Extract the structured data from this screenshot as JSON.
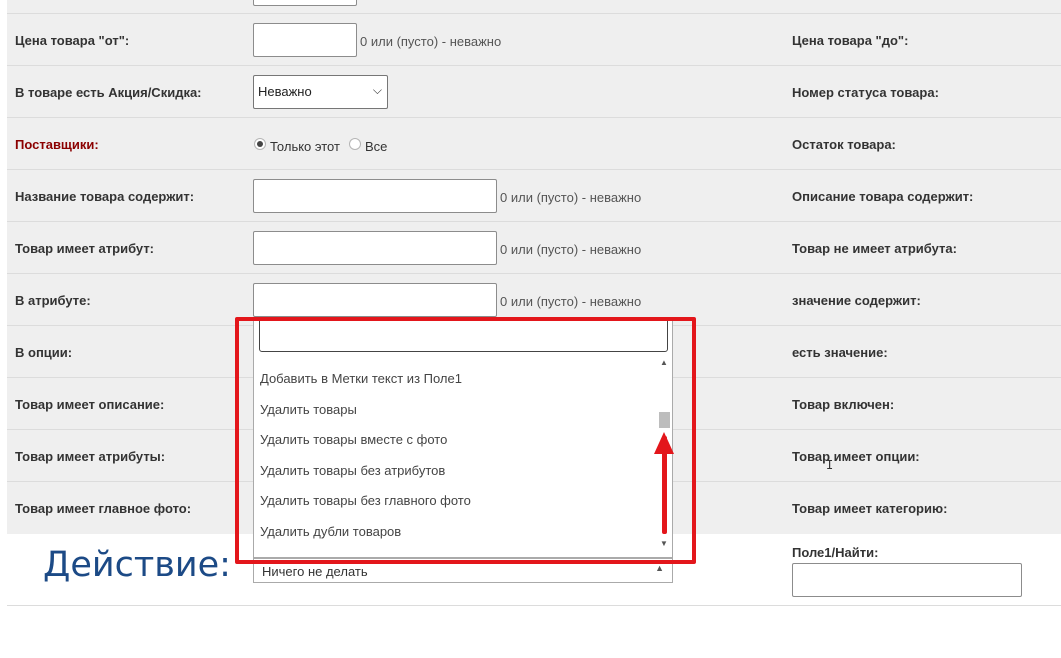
{
  "form": {
    "price_from_label": "Цена товара \"от\":",
    "price_from_hint": "0 или (пусто) - неважно",
    "price_to_label": "Цена товара \"до\":",
    "promo_label": "В товаре есть Акция/Скидка:",
    "promo_value": "Неважно",
    "status_number_label": "Номер статуса товара:",
    "suppliers_label": "Поставщики:",
    "supplier_only_this": "Только этот",
    "supplier_all": "Все",
    "stock_label": "Остаток товара:",
    "name_contains_label": "Название товара содержит:",
    "name_contains_hint": "0 или (пусто) - неважно",
    "description_contains_label": "Описание товара содержит:",
    "has_attribute_label": "Товар имеет атрибут:",
    "has_attribute_hint": "0 или (пусто) - неважно",
    "no_attribute_label": "Товар не имеет атрибута:",
    "in_attribute_label": "В атрибуте:",
    "in_attribute_hint": "0 или (пусто) - неважно",
    "value_contains_label": "значение содержит:",
    "in_option_label": "В опции:",
    "has_value_label": "есть значение:",
    "has_description_label": "Товар имеет описание:",
    "enabled_label": "Товар включен:",
    "has_attributes_label": "Товар имеет атрибуты:",
    "has_options_label": "Товар имеет опции:",
    "has_main_photo_label": "Товар имеет главное фото:",
    "has_category_label": "Товар имеет категорию:"
  },
  "action": {
    "title": "Действие:",
    "selected": "Ничего не делать",
    "field1_label": "Поле1/Найти:"
  },
  "dropdown": {
    "items": [
      "Добавить в Метки текст из Поле1",
      "Удалить товары",
      "Удалить товары вместе с фото",
      "Удалить товары без атрибутов",
      "Удалить товары без главного фото",
      "Удалить дубли товаров"
    ]
  },
  "colors": {
    "annotation": "#e3161b",
    "supplier_label": "#8b0000",
    "action_title": "#1c4a86"
  }
}
